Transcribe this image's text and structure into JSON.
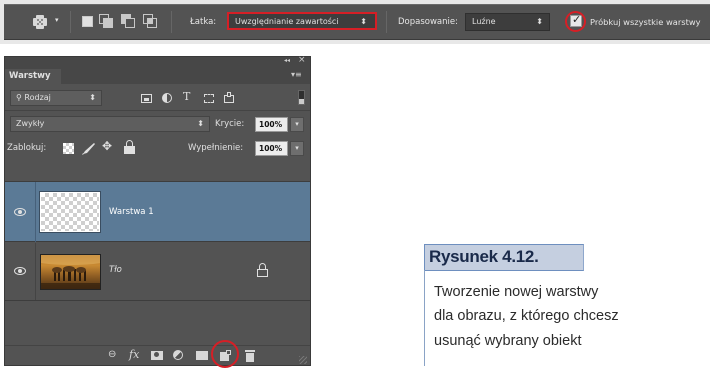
{
  "options_bar": {
    "patch_label": "Łatka:",
    "patch_value": "Uwzględnianie zawartości",
    "adaptation_label": "Dopasowanie:",
    "adaptation_value": "Luźne",
    "sample_all_label": "Próbkuj wszystkie warstwy",
    "sample_all_checked": true
  },
  "layers_panel": {
    "tab_label": "Warstwy",
    "collapse_glyph": "◂◂",
    "close_glyph": "×",
    "menu_glyph": "▾≡",
    "filter_label": "Rodzaj",
    "blend_mode": "Zwykły",
    "opacity_label": "Krycie:",
    "opacity_value": "100%",
    "lock_label": "Zablokuj:",
    "fill_label": "Wypełnienie:",
    "fill_value": "100%",
    "layers": [
      {
        "name": "Warstwa 1",
        "selected": true,
        "visible": true
      },
      {
        "name": "Tło",
        "selected": false,
        "visible": true,
        "locked": true
      }
    ],
    "footer_icons": [
      "link-icon",
      "fx-icon",
      "mask-icon",
      "adjustment-icon",
      "folder-icon",
      "new-layer-icon",
      "trash-icon"
    ],
    "fx_label": "fx"
  },
  "caption": {
    "title": "Rysunek 4.12.",
    "lines": [
      "Tworzenie nowej warstwy",
      "dla obrazu, z którego chcesz",
      "usunąć wybrany obiekt"
    ]
  },
  "colors": {
    "highlight_red": "#d61f26",
    "selected_row": "#5b7a96",
    "panel_bg": "#535353",
    "caption_box": "#c5cfe0"
  }
}
